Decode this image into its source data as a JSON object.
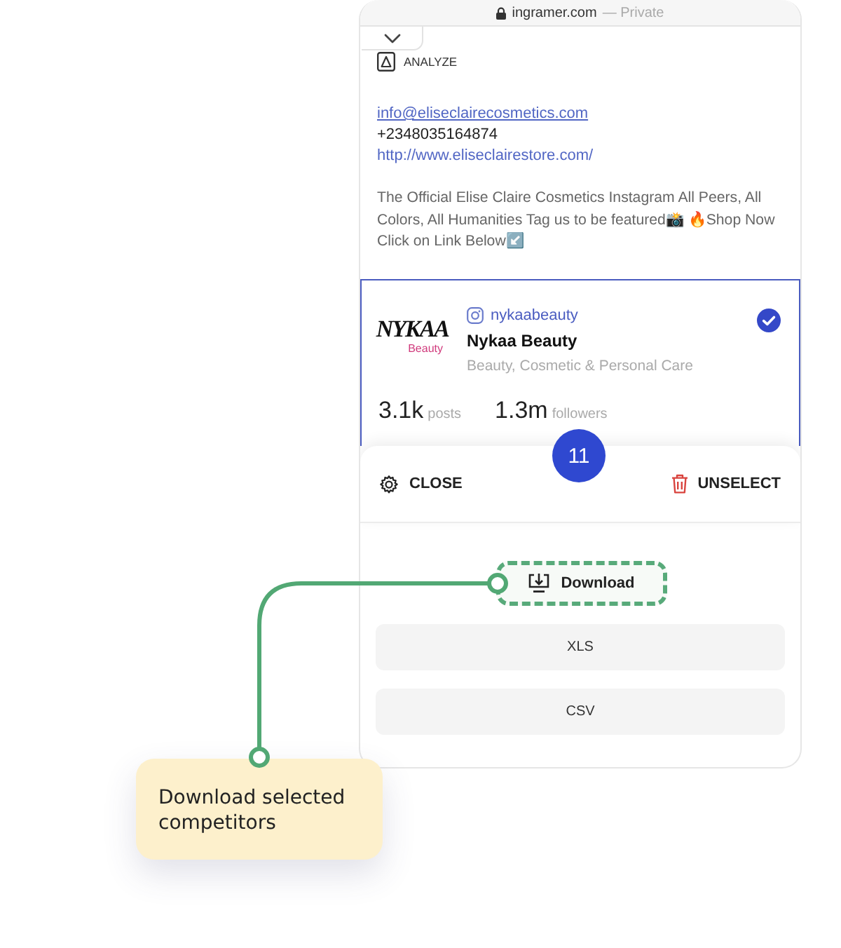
{
  "browser_bar": {
    "domain": "ingramer.com",
    "mode": "— Private"
  },
  "profile": {
    "analyze_label": "ANALYZE",
    "email": "info@eliseclairecosmetics.com",
    "phone": "+2348035164874",
    "website": "http://www.eliseclairestore.com/",
    "bio": "The Official Elise Claire Cosmetics Instagram All Peers, All Colors, All Humanities Tag us to be featured📸 🔥Shop Now Click on Link Below↙️"
  },
  "competitor_card": {
    "selected": true,
    "logo": {
      "wordmark": "NYKAA",
      "subtitle": "Beauty"
    },
    "handle": "nykaabeauty",
    "name": "Nykaa Beauty",
    "category": "Beauty, Cosmetic & Personal Care",
    "stats": [
      {
        "value": "3.1k",
        "label": "posts"
      },
      {
        "value": "1.3m",
        "label": "followers"
      }
    ]
  },
  "selection_bar": {
    "count": "11",
    "close_label": "CLOSE",
    "unselect_label": "UNSELECT"
  },
  "export": {
    "download_label": "Download",
    "formats": [
      "XLS",
      "CSV"
    ]
  },
  "callout": {
    "text": "Download selected competitors"
  }
}
